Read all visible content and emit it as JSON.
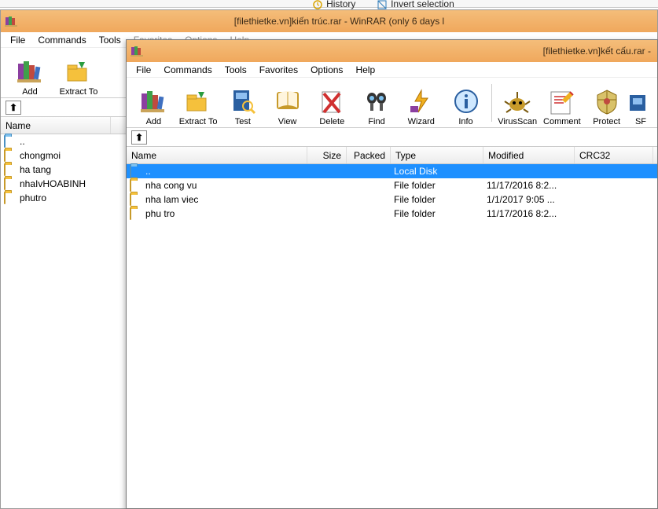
{
  "background_fragments": {
    "history": "History",
    "invert": "Invert selection"
  },
  "window1": {
    "title": "[filethietke.vn]kiến trúc.rar - WinRAR (only 6 days l",
    "menu": {
      "file": "File",
      "commands": "Commands",
      "tools": "Tools",
      "favorites": "Favorites",
      "options": "Options",
      "help": "Help"
    },
    "toolbar": {
      "add": "Add",
      "extract": "Extract To"
    },
    "up_arrow": "⬆",
    "columns": {
      "name": "Name"
    },
    "rows": [
      {
        "name": ".."
      },
      {
        "name": "chongmoi"
      },
      {
        "name": "ha tang"
      },
      {
        "name": "nhaIvHOABINH"
      },
      {
        "name": "phutro"
      }
    ]
  },
  "window2": {
    "title": "[filethietke.vn]kết cấu.rar -",
    "menu": {
      "file": "File",
      "commands": "Commands",
      "tools": "Tools",
      "favorites": "Favorites",
      "options": "Options",
      "help": "Help"
    },
    "toolbar": {
      "add": "Add",
      "extract": "Extract To",
      "test": "Test",
      "view": "View",
      "delete": "Delete",
      "find": "Find",
      "wizard": "Wizard",
      "info": "Info",
      "virus": "VirusScan",
      "comment": "Comment",
      "protect": "Protect",
      "sfx": "SF"
    },
    "up_arrow": "⬆",
    "columns": {
      "name": "Name",
      "size": "Size",
      "packed": "Packed",
      "type": "Type",
      "modified": "Modified",
      "crc": "CRC32"
    },
    "rows": [
      {
        "name": "..",
        "type": "Local Disk",
        "modified": ""
      },
      {
        "name": "nha cong vu",
        "type": "File folder",
        "modified": "11/17/2016 8:2..."
      },
      {
        "name": "nha lam viec",
        "type": "File folder",
        "modified": "1/1/2017 9:05 ..."
      },
      {
        "name": "phu tro",
        "type": "File folder",
        "modified": "11/17/2016 8:2..."
      }
    ]
  }
}
